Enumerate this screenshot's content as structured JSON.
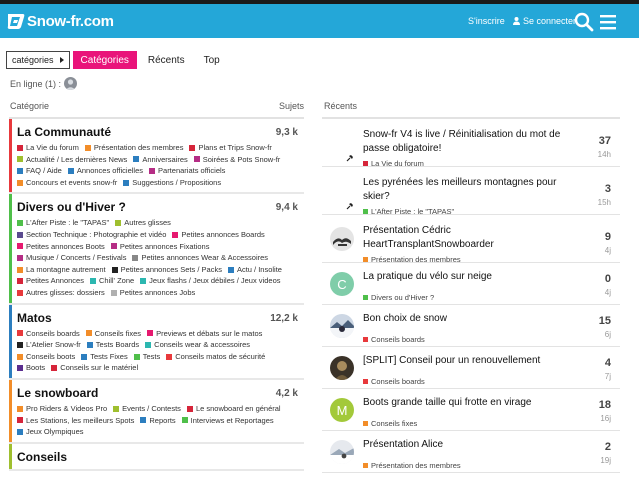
{
  "header": {
    "logo_text": "Snow-fr.com",
    "signup": "S'inscrire",
    "login": "Se connecter"
  },
  "nav": {
    "dropdown": "catégories",
    "pills": [
      "Catégories",
      "Récents",
      "Top"
    ]
  },
  "online": {
    "label": "En ligne (1) :"
  },
  "columns": {
    "category": "Catégorie",
    "topics": "Sujets",
    "recent": "Récents"
  },
  "categories": [
    {
      "title": "La Communauté",
      "count": "9,3 k",
      "color": "#e8393c",
      "subs": [
        {
          "label": "La Vie du forum",
          "color": "#d6253a"
        },
        {
          "label": "Présentation des membres",
          "color": "#f28d29"
        },
        {
          "label": "Plans et Trips Snow-fr",
          "color": "#d6253a"
        },
        {
          "label": "Actualité / Les dernières News",
          "color": "#9fbf2f"
        },
        {
          "label": "Anniversaires",
          "color": "#2c7ebf"
        },
        {
          "label": "Soirées & Pots Snow-fr",
          "color": "#b52d85"
        },
        {
          "label": "FAQ / Aide",
          "color": "#2c7ebf"
        },
        {
          "label": "Annonces officielles",
          "color": "#2c7ebf"
        },
        {
          "label": "Partenariats officiels",
          "color": "#b52d85"
        },
        {
          "label": "Concours et events snow-fr",
          "color": "#f28d29"
        },
        {
          "label": "Suggestions / Propositions",
          "color": "#2c7ebf"
        }
      ]
    },
    {
      "title": "Divers ou d'Hiver ?",
      "count": "9,4 k",
      "color": "#4fbf4a",
      "subs": [
        {
          "label": "L'After Piste : le \"TAPAS\"",
          "color": "#4fbf4a"
        },
        {
          "label": "Autres glisses",
          "color": "#9fbf2f"
        },
        {
          "label": "Section Technique : Photographie et vidéo",
          "color": "#5a4a8f"
        },
        {
          "label": "Petites annonces Boards",
          "color": "#e6196f"
        },
        {
          "label": "Petites annonces Boots",
          "color": "#e6196f"
        },
        {
          "label": "Petites annonces Fixations",
          "color": "#b52d85"
        },
        {
          "label": "Musique / Concerts / Festivals",
          "color": "#b52d85"
        },
        {
          "label": "Petites annonces Wear & Accessoires",
          "color": "#888888"
        },
        {
          "label": "La montagne autrement",
          "color": "#f28d29"
        },
        {
          "label": "Petites annonces Sets / Packs",
          "color": "#222222"
        },
        {
          "label": "Actu / Insolite",
          "color": "#2c7ebf"
        },
        {
          "label": "Petites Annonces",
          "color": "#d6253a"
        },
        {
          "label": "Chill' Zone",
          "color": "#2cb7b0"
        },
        {
          "label": "Jeux flashs / Jeux débiles / Jeux videos",
          "color": "#2cb7b0"
        },
        {
          "label": "Autres glisses: dossiers",
          "color": "#e8393c"
        },
        {
          "label": "Petites annonces Jobs",
          "color": "#b0b0b0"
        }
      ]
    },
    {
      "title": "Matos",
      "count": "12,2 k",
      "color": "#2c7ebf",
      "subs": [
        {
          "label": "Conseils boards",
          "color": "#e8393c"
        },
        {
          "label": "Conseils fixes",
          "color": "#f28d29"
        },
        {
          "label": "Previews et débats sur le matos",
          "color": "#e6196f"
        },
        {
          "label": "L'Atelier Snow-fr",
          "color": "#222222"
        },
        {
          "label": "Tests Boards",
          "color": "#2c7ebf"
        },
        {
          "label": "Conseils wear & accessoires",
          "color": "#2cb7b0"
        },
        {
          "label": "Conseils boots",
          "color": "#f28d29"
        },
        {
          "label": "Tests Fixes",
          "color": "#2c7ebf"
        },
        {
          "label": "Tests",
          "color": "#4fbf4a"
        },
        {
          "label": "Conseils matos de sécurité",
          "color": "#e8393c"
        },
        {
          "label": "Boots",
          "color": "#5a2d8f"
        },
        {
          "label": "Conseils sur le matériel",
          "color": "#d6253a"
        }
      ]
    },
    {
      "title": "Le snowboard",
      "count": "4,2 k",
      "color": "#f28d29",
      "subs": [
        {
          "label": "Pro Riders & Videos Pro",
          "color": "#f28d29"
        },
        {
          "label": "Events / Contests",
          "color": "#9fbf2f"
        },
        {
          "label": "Le snowboard en général",
          "color": "#d6253a"
        },
        {
          "label": "Les Stations, les meilleurs Spots",
          "color": "#d6253a"
        },
        {
          "label": "Reports",
          "color": "#2c7ebf"
        },
        {
          "label": "Interviews et Reportages",
          "color": "#4fbf4a"
        },
        {
          "label": "Jeux Olympiques",
          "color": "#2c7ebf"
        }
      ]
    },
    {
      "title": "Conseils",
      "count": "",
      "color": "#9fbf2f",
      "subs": []
    }
  ],
  "recent": [
    {
      "title": "Snow-fr V4 is live / Réinitialisation du mot de passe obligatoire!",
      "category": "La Vie du forum",
      "cat_color": "#d6253a",
      "count": "37",
      "age": "14h",
      "avatar": "pin"
    },
    {
      "title": "Les pyrénées les meilleurs montagnes pour skier?",
      "category": "L'After Piste : le \"TAPAS\"",
      "cat_color": "#4fbf4a",
      "count": "3",
      "age": "15h",
      "avatar": "pin"
    },
    {
      "title": "Présentation Cédric HeartTransplantSnowboarder",
      "category": "Présentation des membres",
      "cat_color": "#f28d29",
      "count": "9",
      "age": "4j",
      "avatar": "photo-gray"
    },
    {
      "title": "La pratique du vélo sur neige",
      "category": "Divers ou d'Hiver ?",
      "cat_color": "#4fbf4a",
      "count": "0",
      "age": "4j",
      "avatar": "C"
    },
    {
      "title": "Bon choix de snow",
      "category": "Conseils boards",
      "cat_color": "#e8393c",
      "count": "15",
      "age": "6j",
      "avatar": "photo-snow"
    },
    {
      "title": "[SPLIT] Conseil pour un renouvellement",
      "category": "Conseils boards",
      "cat_color": "#e8393c",
      "count": "4",
      "age": "7j",
      "avatar": "photo-dark"
    },
    {
      "title": "Boots grande taille qui frotte en virage",
      "category": "Conseils fixes",
      "cat_color": "#f28d29",
      "count": "18",
      "age": "16j",
      "avatar": "M"
    },
    {
      "title": "Présentation Alice",
      "category": "Présentation des membres",
      "cat_color": "#f28d29",
      "count": "2",
      "age": "19j",
      "avatar": "photo-light"
    }
  ]
}
